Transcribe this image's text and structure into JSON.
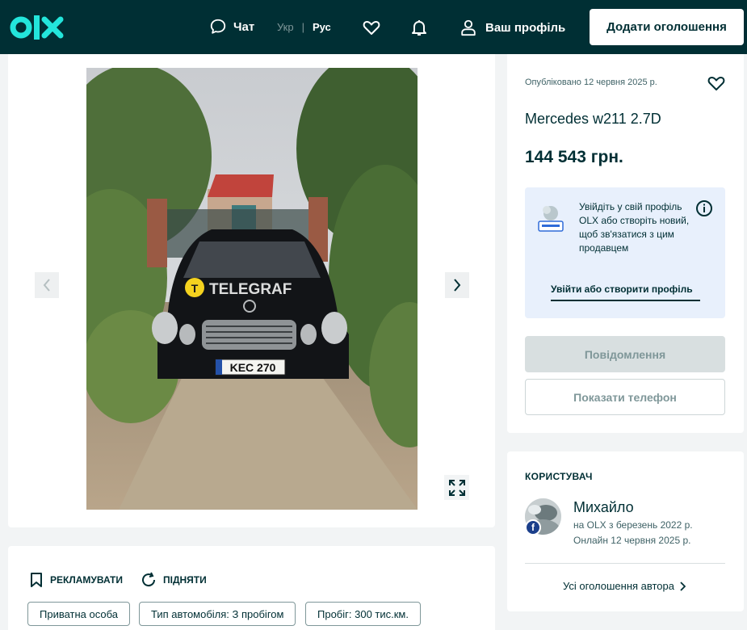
{
  "header": {
    "logo_text": "olx",
    "chat_label": "Чат",
    "lang_ukr": "Укр",
    "lang_sep": "|",
    "lang_rus": "Рус",
    "profile_label": "Ваш профіль",
    "add_button": "Додати оголошення"
  },
  "photo": {
    "watermark": "TELEGRAF",
    "plate": "KEC 270"
  },
  "details": {
    "promote_label": "РЕКЛАМУВАТИ",
    "raise_label": "ПІДНЯТИ",
    "tags": [
      "Приватна особа",
      "Тип автомобіля: З пробігом",
      "Пробіг: 300 тис.км."
    ]
  },
  "ad": {
    "published": "Опубліковано 12 червня 2025 р.",
    "title": "Mercedes w211 2.7D",
    "price": "144 543 грн.",
    "login_text": "Увійдіть у свій профіль OLX або створіть новий, щоб зв'язатися з цим продавцем",
    "login_link": "Увійти або створити профіль",
    "message_button": "Повідомлення",
    "phone_button": "Показати телефон"
  },
  "seller": {
    "heading": "КОРИСТУВАЧ",
    "name": "Михайло",
    "since": "на OLX з березень 2022 р.",
    "online": "Онлайн 12 червня 2025 р.",
    "badge": "f",
    "all_ads": "Усі оголошення автора"
  },
  "colors": {
    "header_bg": "#002f34",
    "accent_box": "#e8f0fc",
    "disabled_button": "#d8dfe0"
  }
}
